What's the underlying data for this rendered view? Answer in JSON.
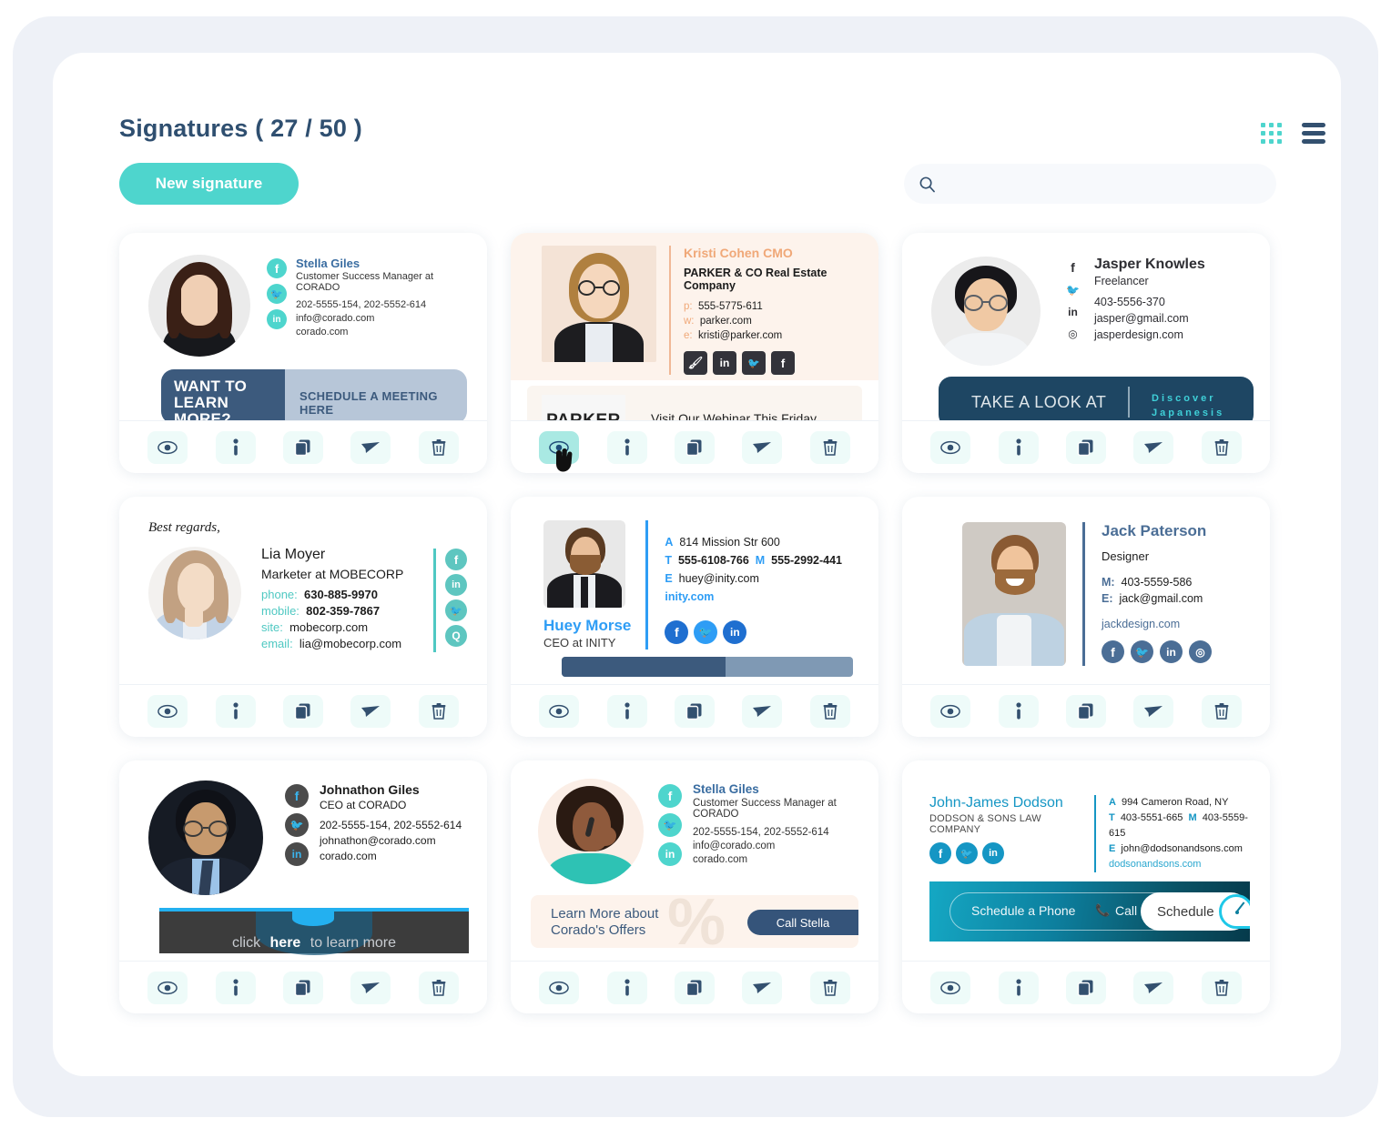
{
  "header": {
    "title": "Signatures ( 27 / 50 )",
    "new_signature_label": "New signature",
    "grid_view_icon": "grid-view-icon",
    "list_view_icon": "list-view-icon"
  },
  "search": {
    "value": "",
    "placeholder": "",
    "icon": "search-icon"
  },
  "action_labels": {
    "preview": "preview-eye-icon",
    "info": "info-icon",
    "duplicate": "duplicate-icon",
    "send": "send-icon",
    "delete": "trash-icon"
  },
  "colors": {
    "accent_teal": "#4ed5cd",
    "navy": "#33506f",
    "page_bg": "#eef1f7",
    "panel_bg": "#ffffff",
    "action_bg": "#eefbf9",
    "action_hover_bg": "#a9e9e3"
  },
  "cards": [
    {
      "id": "stella-giles-corado",
      "name": "Stella Giles",
      "title": "Customer Success Manager at CORADO",
      "phone": "202-5555-154, 202-5552-614",
      "email": "info@corado.com",
      "site": "corado.com",
      "socials": [
        "facebook",
        "twitter",
        "linkedin"
      ],
      "banner_left": "WANT TO LEARN MORE?",
      "banner_right": "SCHEDULE A MEETING HERE",
      "hovered_action": null
    },
    {
      "id": "kristi-cohen-parker",
      "name": "Kristi Cohen CMO",
      "company": "PARKER & CO Real Estate Company",
      "label_p": "p:",
      "phone": "555-5775-611",
      "label_w": "w:",
      "site": "parker.com",
      "label_e": "e:",
      "email": "kristi@parker.com",
      "socials": [
        "behance",
        "linkedin",
        "twitter",
        "facebook"
      ],
      "banner_logo": "PARKER",
      "banner_text": "Visit Our Webinar This Friday",
      "hovered_action": "preview"
    },
    {
      "id": "jasper-knowles-freelancer",
      "name": "Jasper Knowles",
      "title": "Freelancer",
      "phone": "403-5556-370",
      "email": "jasper@gmail.com",
      "site": "jasperdesign.com",
      "socials": [
        "facebook",
        "twitter",
        "linkedin",
        "instagram"
      ],
      "banner_left": "TAKE A LOOK AT",
      "banner_right": "Discover",
      "banner_right2": "Japanesis",
      "hovered_action": null
    },
    {
      "id": "lia-moyer-mobecorp",
      "greeting": "Best regards,",
      "name": "Lia Moyer",
      "title": "Marketer at MOBECORP",
      "label_phone": "phone:",
      "phone": "630-885-9970",
      "label_mobile": "mobile:",
      "mobile": "802-359-7867",
      "label_site": "site:",
      "site": "mobecorp.com",
      "label_email": "email:",
      "email": "lia@mobecorp.com",
      "socials": [
        "facebook",
        "linkedin",
        "twitter",
        "quora"
      ],
      "hovered_action": null
    },
    {
      "id": "huey-morse-inity",
      "name": "Huey Morse",
      "title": "CEO at INITY",
      "label_a": "A",
      "address": "814 Mission Str 600",
      "label_t": "T",
      "phone": "555-6108-766",
      "label_m": "M",
      "mobile": "555-2992-441",
      "label_e": "E",
      "email": "huey@inity.com",
      "site": "inity.com",
      "socials": [
        "facebook",
        "twitter",
        "linkedin"
      ],
      "hovered_action": null
    },
    {
      "id": "jack-paterson-designer",
      "name": "Jack Paterson",
      "title": "Designer",
      "label_m": "M:",
      "mobile": "403-5559-586",
      "label_e": "E:",
      "email": "jack@gmail.com",
      "site": "jackdesign.com",
      "socials": [
        "facebook",
        "twitter",
        "linkedin",
        "instagram"
      ],
      "hovered_action": null
    },
    {
      "id": "johnathon-giles-corado",
      "name": "Johnathon Giles",
      "title": "CEO at CORADO",
      "phone": "202-5555-154, 202-5552-614",
      "email": "johnathon@corado.com",
      "site": "corado.com",
      "socials": [
        "facebook",
        "twitter",
        "linkedin"
      ],
      "banner_text": "click here to learn more",
      "banner_pre": "click",
      "banner_link": "here",
      "banner_post": "to learn more",
      "hovered_action": null
    },
    {
      "id": "stella-giles-offers",
      "name": "Stella Giles",
      "title": "Customer Success Manager at CORADO",
      "phone": "202-5555-154, 202-5552-614",
      "email": "info@corado.com",
      "site": "corado.com",
      "socials": [
        "facebook",
        "twitter",
        "linkedin"
      ],
      "banner_line1": "Learn More about",
      "banner_line2": "Corado's Offers",
      "banner_button": "Call Stella",
      "banner_watermark": "%",
      "hovered_action": null
    },
    {
      "id": "john-james-dodson-law",
      "name": "John-James Dodson",
      "company": "DODSON & SONS LAW COMPANY",
      "label_a": "A",
      "address": "994 Cameron Road, NY",
      "label_t": "T",
      "phone": "403-5551-665",
      "label_m": "M",
      "mobile": "403-5559-615",
      "label_e": "E",
      "email": "john@dodsonandsons.com",
      "site": "dodsonandsons.com",
      "socials": [
        "facebook",
        "twitter",
        "linkedin"
      ],
      "banner_text1": "Schedule a Phone",
      "banner_text2": "Call",
      "banner_button": "Schedule",
      "hovered_action": null
    }
  ]
}
